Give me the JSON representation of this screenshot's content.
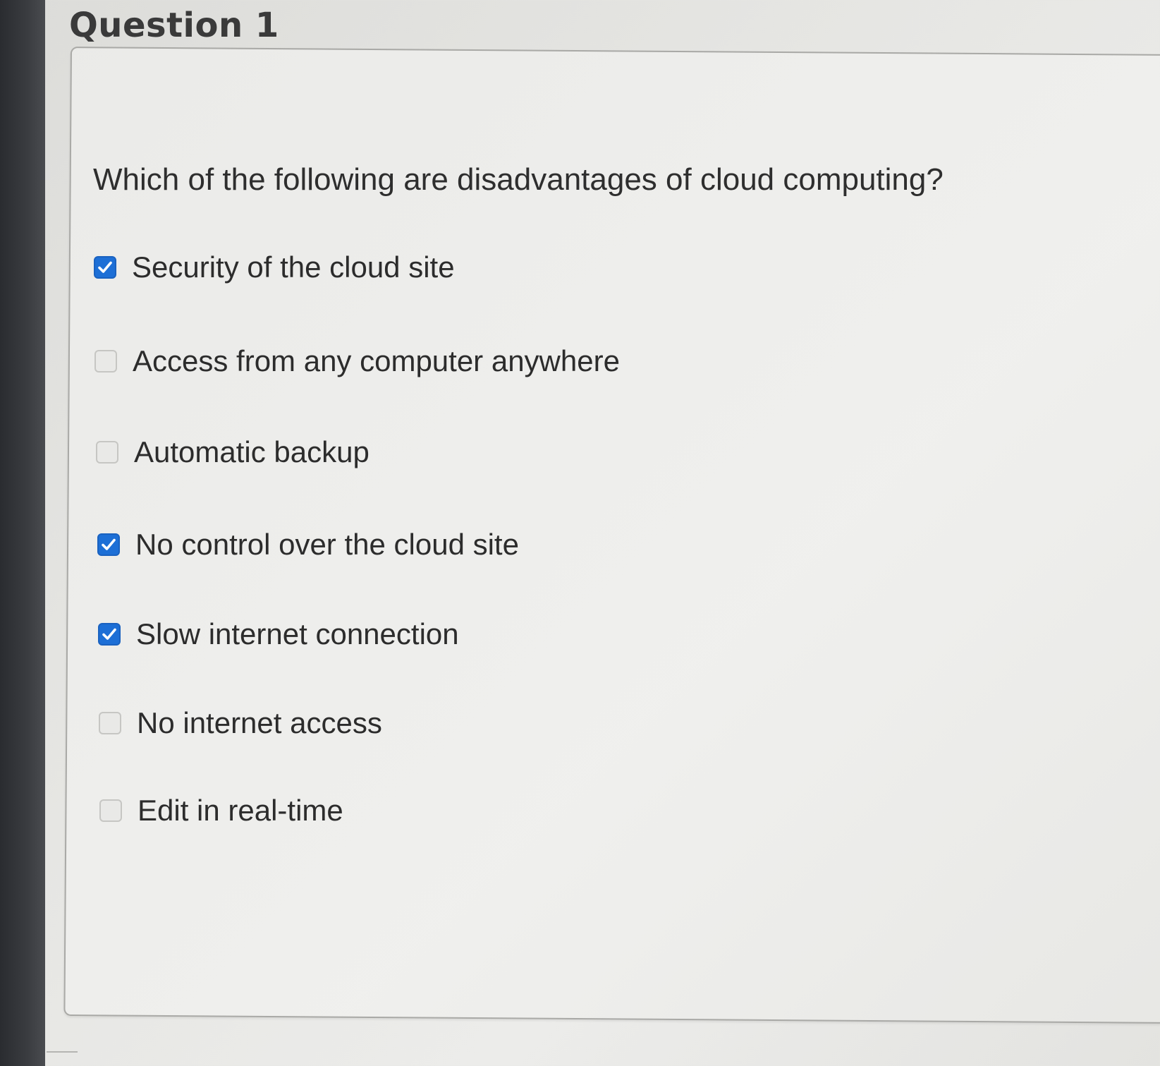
{
  "question": {
    "title": "Question 1",
    "prompt": "Which of the following are disadvantages of cloud computing?",
    "options": [
      {
        "label": "Security of the cloud site",
        "checked": true
      },
      {
        "label": "Access from any computer anywhere",
        "checked": false
      },
      {
        "label": "Automatic backup",
        "checked": false
      },
      {
        "label": "No control over the cloud site",
        "checked": true
      },
      {
        "label": "Slow internet connection",
        "checked": true
      },
      {
        "label": "No internet access",
        "checked": false
      },
      {
        "label": "Edit in real-time",
        "checked": false
      }
    ]
  },
  "colors": {
    "checkbox_checked": "#1d6fd6",
    "checkbox_unchecked_border": "#c6c6c3",
    "text": "#2c2c2c"
  },
  "icons": {
    "checked": "checkmark-icon"
  }
}
